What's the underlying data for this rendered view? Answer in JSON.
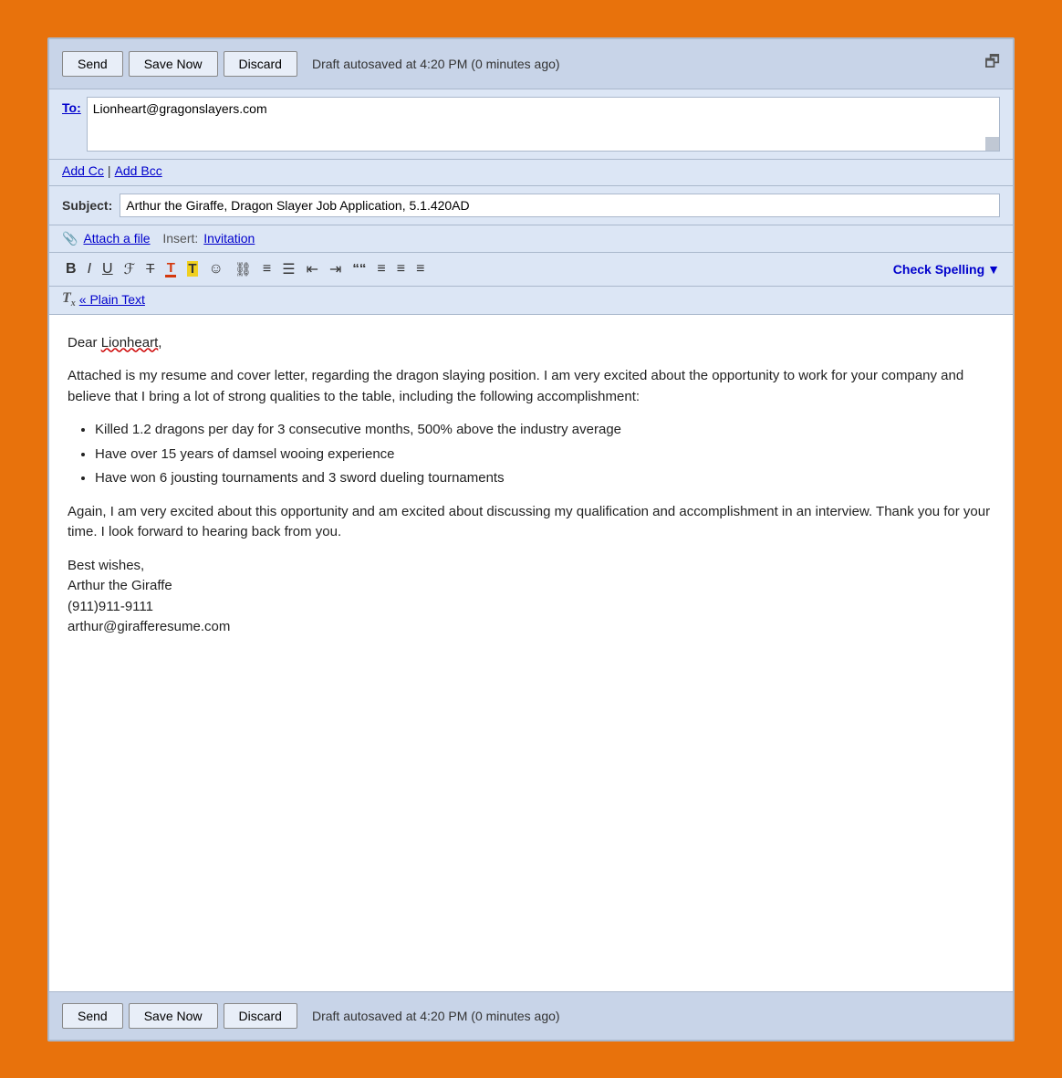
{
  "colors": {
    "orange_border": "#E8720C",
    "toolbar_bg": "#c8d4e8",
    "compose_bg": "#dce6f5",
    "body_bg": "#ffffff"
  },
  "toolbar_top": {
    "send_label": "Send",
    "save_label": "Save Now",
    "discard_label": "Discard",
    "autosave_text": "Draft autosaved at 4:20 PM (0 minutes ago)"
  },
  "to_field": {
    "label": "To:",
    "value": "Lionheart@gragonslayers.com"
  },
  "cc_bcc": {
    "add_cc": "Add Cc",
    "separator": "|",
    "add_bcc": "Add Bcc"
  },
  "subject_field": {
    "label": "Subject:",
    "value": "Arthur the Giraffe, Dragon Slayer Job Application, 5.1.420AD"
  },
  "attach_row": {
    "icon": "📎",
    "attach_link": "Attach a file",
    "insert_text": "Insert:",
    "invitation_link": "Invitation"
  },
  "format_toolbar": {
    "bold": "B",
    "italic": "I",
    "underline": "U",
    "font": "𝓕",
    "strikethrough": "T̶",
    "font_color": "T",
    "highlight": "T",
    "smiley": "☺",
    "link": "🔗",
    "ordered_list": "≡",
    "unordered_list": "≡",
    "indent_less": "⇐",
    "indent_more": "⇒",
    "blockquote": "❝❝",
    "align_left": "≡",
    "align_center": "≡",
    "align_right": "≡",
    "check_spelling": "Check Spelling"
  },
  "plain_text_row": {
    "icon": "Tx",
    "label": "« Plain Text"
  },
  "body": {
    "greeting": "Dear Lionheart,",
    "paragraph1": "Attached is my resume and cover letter, regarding the dragon slaying position.  I am very excited about the opportunity to work for your company and believe that I bring a lot of strong qualities to the table, including the following accomplishment:",
    "bullet1": "Killed 1.2 dragons per day for 3 consecutive months, 500% above the industry average",
    "bullet2": "Have over 15 years of damsel wooing experience",
    "bullet3": "Have won 6 jousting tournaments and 3 sword dueling tournaments",
    "paragraph2": "Again, I am very excited about this opportunity and am excited about discussing my qualification and accomplishment in an interview.  Thank you for your time.  I look forward to hearing back from you.",
    "signature_line1": "Best wishes,",
    "signature_line2": "Arthur the Giraffe",
    "signature_line3": "(911)911-9111",
    "signature_line4": "arthur@girafferesume.com"
  },
  "toolbar_bottom": {
    "send_label": "Send",
    "save_label": "Save Now",
    "discard_label": "Discard",
    "autosave_text": "Draft autosaved at 4:20 PM (0 minutes ago)"
  }
}
